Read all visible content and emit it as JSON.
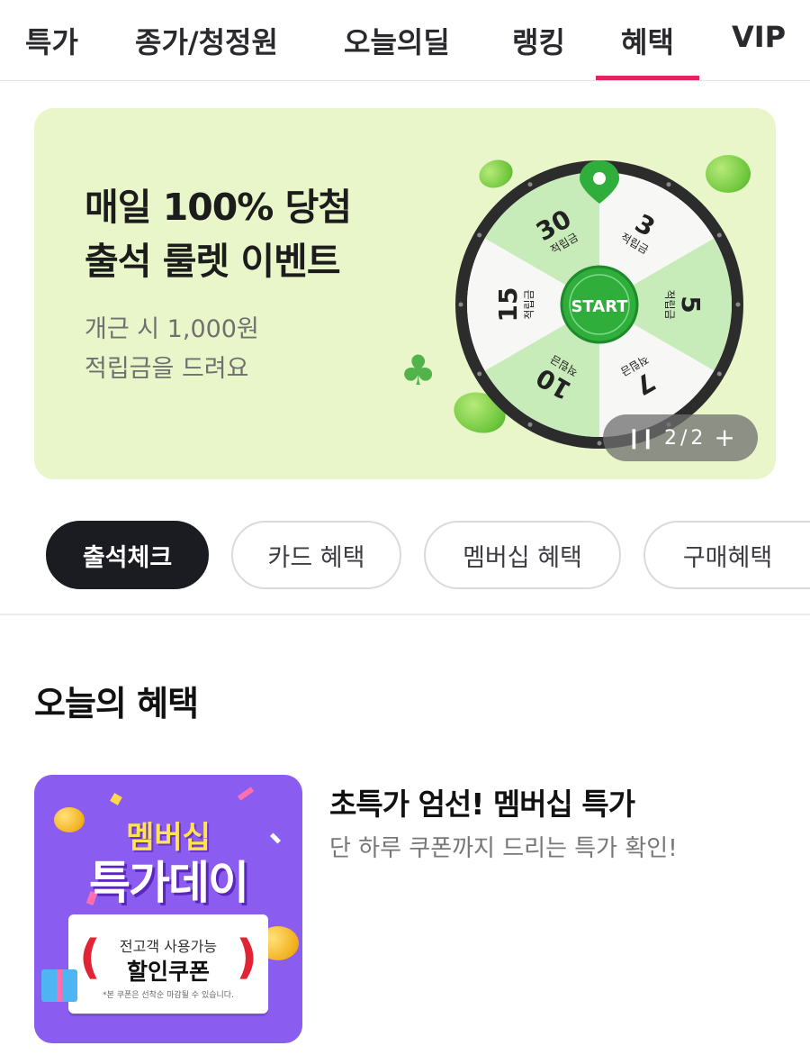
{
  "top_tabs": [
    {
      "label": "특가"
    },
    {
      "label": "종가/청정원"
    },
    {
      "label": "오늘의딜"
    },
    {
      "label": "랭킹"
    },
    {
      "label": "혜택",
      "active": true
    },
    {
      "label": "VIP"
    }
  ],
  "banner": {
    "title_line1": "매일 100% 당첨",
    "title_line2": "출석 룰렛 이벤트",
    "subtitle_line1": "개근 시 1,000원",
    "subtitle_line2": "적립금을 드려요",
    "wheel": {
      "start_label": "START",
      "segment_unit": "적립금",
      "segments": [
        "3",
        "5",
        "7",
        "10",
        "15",
        "30"
      ]
    },
    "indicator": {
      "pause_icon": "pause-icon",
      "current": "2",
      "separator": "/",
      "total": "2",
      "expand_icon": "plus-icon"
    }
  },
  "chips": [
    {
      "label": "출석체크",
      "active": true
    },
    {
      "label": "카드 혜택"
    },
    {
      "label": "멤버십 혜택"
    },
    {
      "label": "구매혜택"
    }
  ],
  "section": {
    "title": "오늘의 혜택"
  },
  "benefit": {
    "title": "초특가 엄선! 멤버십 특가",
    "description": "단 하루 쿠폰까지 드리는 특가 확인!",
    "thumbnail": {
      "line1": "멤버십",
      "line2": "특가데이",
      "coupon_top": "전고객 사용가능",
      "coupon_main": "할인쿠폰",
      "coupon_note": "*본 쿠폰은 선착순 마감될 수 있습니다."
    }
  },
  "colors": {
    "accent": "#e4245f",
    "banner_bg": "#e8f6c9",
    "wheel_green": "#2fae3c",
    "thumb_purple": "#8b5cf0"
  }
}
